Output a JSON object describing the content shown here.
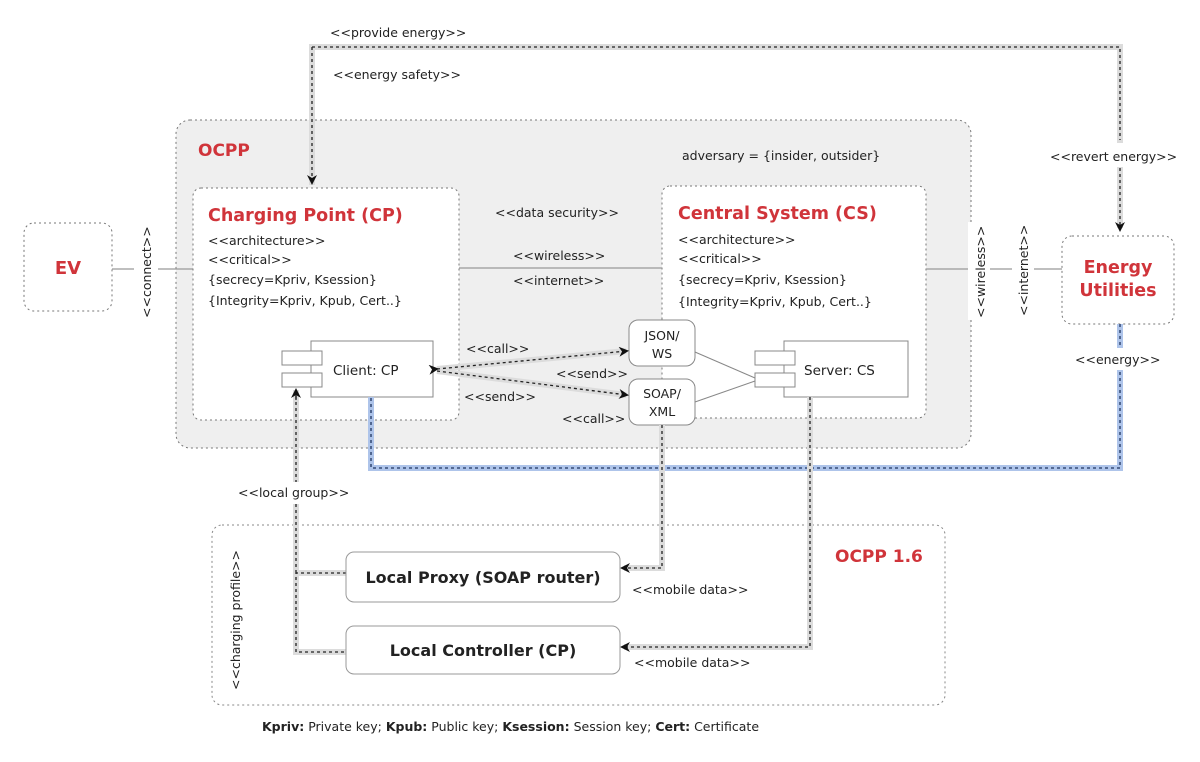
{
  "colors": {
    "accent_red": "#d0343a",
    "region_fill": "#efefef",
    "energy_line": "#aec4ea",
    "flow_shadow": "#dcdcdc",
    "text": "#222222"
  },
  "regions": {
    "ocpp": {
      "title": "OCPP",
      "adversary": "adversary = {insider, outsider}"
    },
    "ocpp16": {
      "title": "OCPP 1.6",
      "side_label": "<<charging profile>>"
    }
  },
  "nodes": {
    "ev": {
      "title": "EV"
    },
    "energy_utilities": {
      "title_line1": "Energy",
      "title_line2": "Utilities"
    },
    "charging_point": {
      "title": "Charging Point (CP)",
      "stereotypes": [
        "<<architecture>>",
        "<<critical>>",
        "{secrecy=Kpriv, Ksession}",
        "{Integrity=Kpriv, Kpub, Cert..}"
      ],
      "component": "Client: CP"
    },
    "central_system": {
      "title": "Central System (CS)",
      "stereotypes": [
        "<<architecture>>",
        "<<critical>>",
        "{secrecy=Kpriv, Ksession}",
        "{Integrity=Kpriv, Kpub, Cert..}"
      ],
      "component": "Server: CS"
    },
    "json_ws": {
      "line1": "JSON/",
      "line2": "WS"
    },
    "soap_xml": {
      "line1": "SOAP/",
      "line2": "XML"
    },
    "local_proxy": {
      "title": "Local Proxy (SOAP router)"
    },
    "local_controller": {
      "title": "Local Controller (CP)"
    }
  },
  "edges": {
    "provide_energy": "<<provide energy>>",
    "energy_safety": "<<energy safety>>",
    "revert_energy": "<<revert energy>>",
    "connect": "<<connect>>",
    "data_security": "<<data security>>",
    "cp_cs_wireless": "<<wireless>>",
    "cp_cs_internet": "<<internet>>",
    "cs_eu_wireless": "<<wireless>>",
    "cs_eu_internet": "<<internet>>",
    "energy": "<<energy>>",
    "call_json": "<<call>>",
    "send_json": "<<send>>",
    "send_soap": "<<send>>",
    "call_soap": "<<call>>",
    "local_group": "<<local group>>",
    "mobile_data_proxy": "<<mobile data>>",
    "mobile_data_controller": "<<mobile data>>"
  },
  "legend": [
    {
      "term": "Kpriv:",
      "desc": " Private key; "
    },
    {
      "term": "Kpub:",
      "desc": " Public key; "
    },
    {
      "term": "Ksession:",
      "desc": " Session key; "
    },
    {
      "term": "Cert:",
      "desc": " Certificate"
    }
  ]
}
